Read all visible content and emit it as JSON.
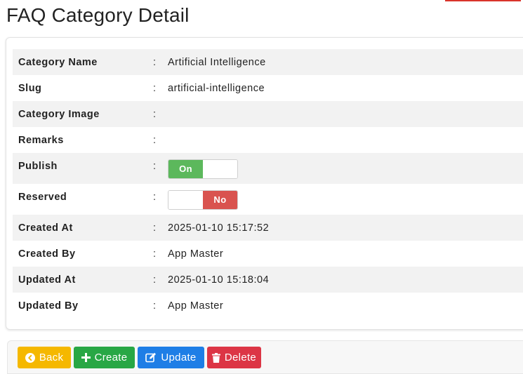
{
  "page": {
    "title": "FAQ Category Detail"
  },
  "details": [
    {
      "label": "Category Name",
      "value": "Artificial Intelligence"
    },
    {
      "label": "Slug",
      "value": "artificial-intelligence"
    },
    {
      "label": "Category Image",
      "value": ""
    },
    {
      "label": "Remarks",
      "value": ""
    },
    {
      "label": "Publish",
      "toggle": "On",
      "state": true
    },
    {
      "label": "Reserved",
      "toggle": "No",
      "state": false
    },
    {
      "label": "Created At",
      "value": "2025-01-10 15:17:52"
    },
    {
      "label": "Created By",
      "value": "App Master"
    },
    {
      "label": "Updated At",
      "value": "2025-01-10 15:18:04"
    },
    {
      "label": "Updated By",
      "value": "App Master"
    }
  ],
  "separator": ":",
  "actions": {
    "back_label": "Back",
    "create_label": "Create",
    "update_label": "Update",
    "delete_label": "Delete"
  },
  "icons": {
    "back": "chevron-circle-left-icon",
    "create": "plus-icon",
    "update": "edit-icon",
    "delete": "trash-icon"
  },
  "colors": {
    "on": "#5cb85c",
    "no": "#d9534f",
    "back": "#f5b800",
    "create": "#28a745",
    "update": "#1e7ee6",
    "delete": "#dc3545"
  }
}
